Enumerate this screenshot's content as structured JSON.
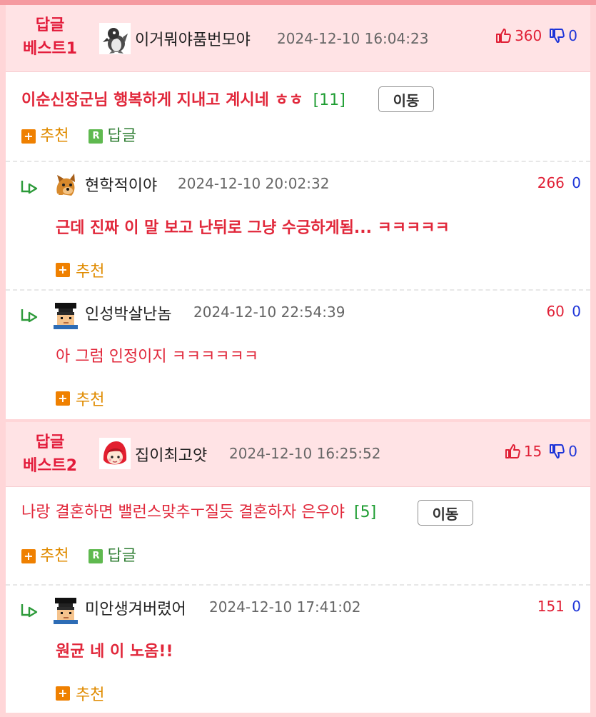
{
  "best1": {
    "tag_line1": "답글",
    "tag_line2": "베스트1",
    "nickname": "이거뭐야품번모야",
    "timestamp": "2024-12-10 16:04:23",
    "up_votes": "360",
    "down_votes": "0",
    "comment": "이순신장군님 행복하게 지내고 계시네 ㅎㅎ",
    "reply_count": "[11]",
    "move_label": "이동",
    "recommend_label": "추천",
    "reply_label": "답글",
    "replies": [
      {
        "nickname": "현학적이야",
        "timestamp": "2024-12-10 20:02:32",
        "up_votes": "266",
        "down_votes": "0",
        "text": "근데 진짜 이 말 보고 난뒤로 그냥 수긍하게됨... ㅋㅋㅋㅋㅋ",
        "recommend_label": "추천"
      },
      {
        "nickname": "인성박살난놈",
        "timestamp": "2024-12-10 22:54:39",
        "up_votes": "60",
        "down_votes": "0",
        "text": "아 그럼 인정이지 ㅋㅋㅋㅋㅋㅋ",
        "recommend_label": "추천"
      }
    ]
  },
  "best2": {
    "tag_line1": "답글",
    "tag_line2": "베스트2",
    "nickname": "집이최고얏",
    "timestamp": "2024-12-10 16:25:52",
    "up_votes": "15",
    "down_votes": "0",
    "comment": "나랑 결혼하면 밸런스맞추ㅜ질듯 결혼하자 은우야",
    "reply_count": "[5]",
    "move_label": "이동",
    "recommend_label": "추천",
    "reply_label": "답글",
    "replies": [
      {
        "nickname": "미안생겨버렸어",
        "timestamp": "2024-12-10 17:41:02",
        "up_votes": "151",
        "down_votes": "0",
        "text": "원균 네 이 노옴!!",
        "recommend_label": "추천"
      }
    ]
  },
  "colors": {
    "accent_red": "#e1273a",
    "best_header_bg": "#ffe3e5",
    "page_pink": "#ffd6d8",
    "reply_green": "#1e9d32",
    "down_blue": "#1d34d8",
    "recommend_orange": "#e08b00"
  },
  "icons": {
    "thumb_up": "thumb-up-icon",
    "thumb_down": "thumb-down-icon",
    "plus": "plus-icon",
    "reply": "reply-r-icon",
    "reply_arrow": "reply-arrow-icon"
  }
}
